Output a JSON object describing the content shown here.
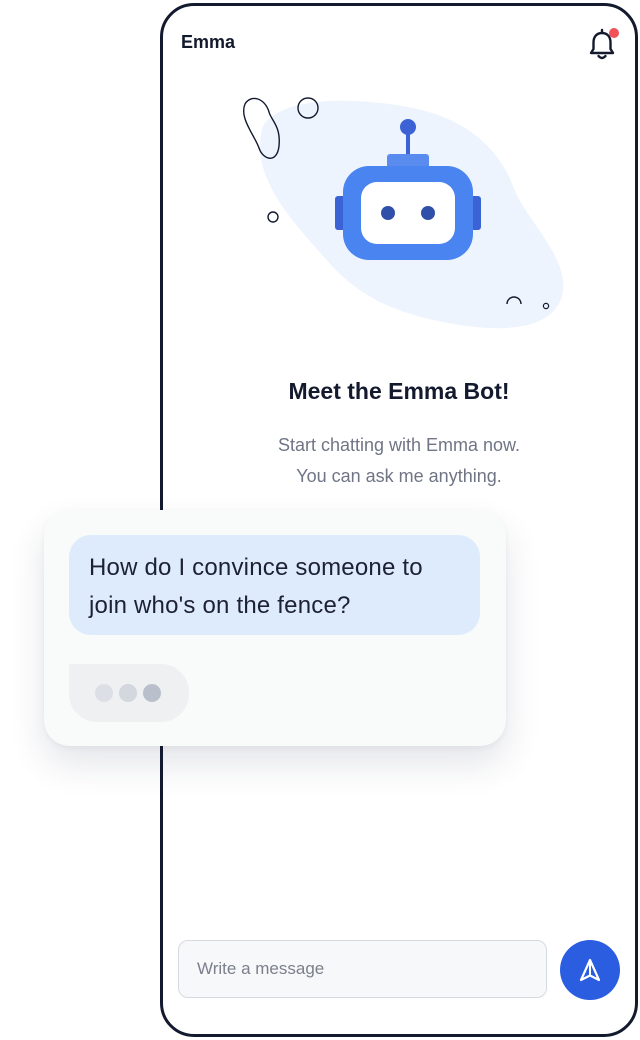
{
  "header": {
    "app_name": "Emma",
    "notification_icon": "bell-icon",
    "notification_dot_color": "#f05258"
  },
  "hero": {
    "illustration_icon": "robot-icon",
    "title": "Meet the Emma Bot!",
    "subtitle_line1": "Start chatting with Emma now.",
    "subtitle_line2": "You can ask me anything."
  },
  "chat": {
    "user_message": "How do I convince someone to join who's on the fence?",
    "typing_indicator_icon": "typing-dots-icon"
  },
  "composer": {
    "placeholder": "Write a message",
    "value": "",
    "send_icon": "send-icon"
  },
  "colors": {
    "accent": "#2a5de0",
    "robot_blue": "#4a84f0",
    "user_bubble": "#ddebfd",
    "text_dark": "#141a2e",
    "text_muted": "#6f7585"
  }
}
